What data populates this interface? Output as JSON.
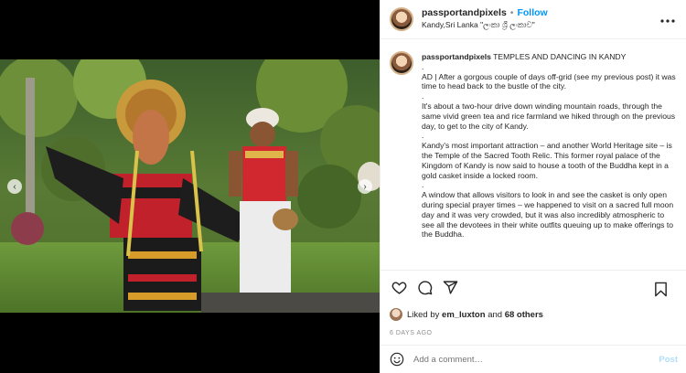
{
  "header": {
    "username": "passportandpixels",
    "separator": "•",
    "follow_label": "Follow",
    "location": "Kandy,Sri Lanka \"ලංකා ශ්‍රී ලංකාව\"",
    "more_icon": "more-horizontal-icon"
  },
  "caption": {
    "username": "passportandpixels",
    "title": "TEMPLES AND DANCING IN KANDY",
    "paragraphs": [
      "AD | After a gorgous couple of days off-grid (see my previous post) it was time to head back to the bustle of the city.",
      "It's about a two-hour drive down winding mountain roads, through the same vivid green tea and rice farmland we hiked through on the previous day, to get to the city of Kandy.",
      "Kandy's most important attraction – and another World Heritage site – is the Temple of the Sacred Tooth Relic. This former royal palace of the Kingdom of Kandy is now said to house a tooth of the Buddha kept in a gold casket inside a locked room.",
      "A window that allows visitors to look in and see the casket is only open during special prayer times – we happened to visit on a sacred full moon day and it was very crowded, but it was also incredibly atmospheric to see all the devotees in their white outfits queuing up to make offerings to the Buddha."
    ],
    "dot": "."
  },
  "actions": {
    "like_icon": "heart-icon",
    "comment_icon": "comment-icon",
    "share_icon": "share-icon",
    "save_icon": "bookmark-icon"
  },
  "likes": {
    "prefix": "Liked by",
    "user": "em_luxton",
    "and": "and",
    "others": "68 others"
  },
  "timestamp": "6 DAYS AGO",
  "comment_box": {
    "placeholder": "Add a comment…",
    "post_label": "Post"
  },
  "carousel": {
    "prev_glyph": "‹",
    "next_glyph": "›"
  },
  "colors": {
    "link_blue": "#0095f6",
    "post_disabled": "#b2dffc",
    "muted": "#8e8e8e"
  }
}
